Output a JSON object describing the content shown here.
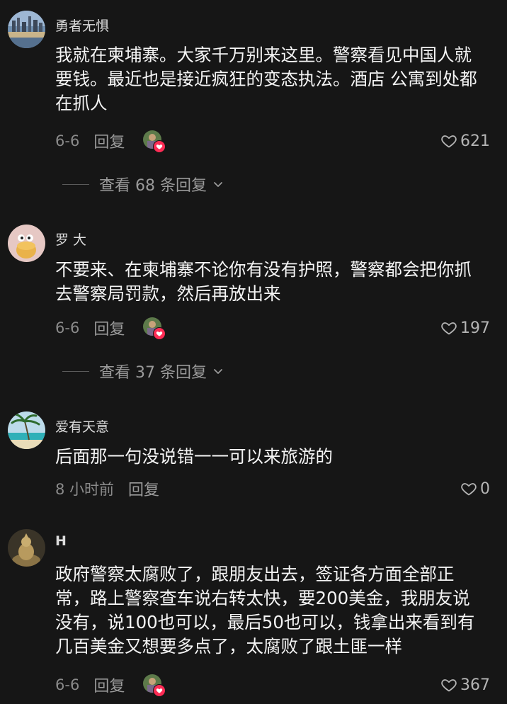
{
  "comments": [
    {
      "username": "勇者无惧",
      "avatar_icon": "city-skyline-avatar-icon",
      "lines": [
        "我就在柬埔寨。大家千万别来这里。警察看见中国人就",
        "要钱。最近也是接近疯狂的变态执法。酒店 公寓到处都",
        "在抓人"
      ],
      "date": "6-6",
      "reply_label": "回复",
      "likes": "621",
      "view_replies": "查看 68 条回复"
    },
    {
      "username": "罗 大",
      "avatar_icon": "cartoon-cookie-avatar-icon",
      "lines": [
        "不要来、在柬埔寨不论你有没有护照，警察都会把你抓",
        "去警察局罚款，然后再放出来"
      ],
      "date": "6-6",
      "reply_label": "回复",
      "likes": "197",
      "view_replies": "查看 37 条回复"
    },
    {
      "username": "爱有天意",
      "avatar_icon": "palm-beach-avatar-icon",
      "lines": [
        "后面那一句没说错一一可以来旅游的"
      ],
      "date": "8 小时前",
      "reply_label": "回复",
      "likes": "0"
    },
    {
      "username": "H",
      "avatar_icon": "buddha-statue-avatar-icon",
      "lines": [
        "政府警察太腐败了，跟朋友出去，签证各方面全部正",
        "常，路上警察查车说右转太快，要200美金，我朋友说",
        "没有，说100也可以，最后50也可以，钱拿出来看到有",
        "几百美金又想要多点了，太腐败了跟土匪一样"
      ],
      "date": "6-6",
      "reply_label": "回复",
      "likes": "367"
    }
  ],
  "colors": {
    "background": "#161616",
    "text_primary": "#f4f4f4",
    "text_secondary": "#9a9a9a",
    "creator_like_badge": "#fe2c55"
  }
}
